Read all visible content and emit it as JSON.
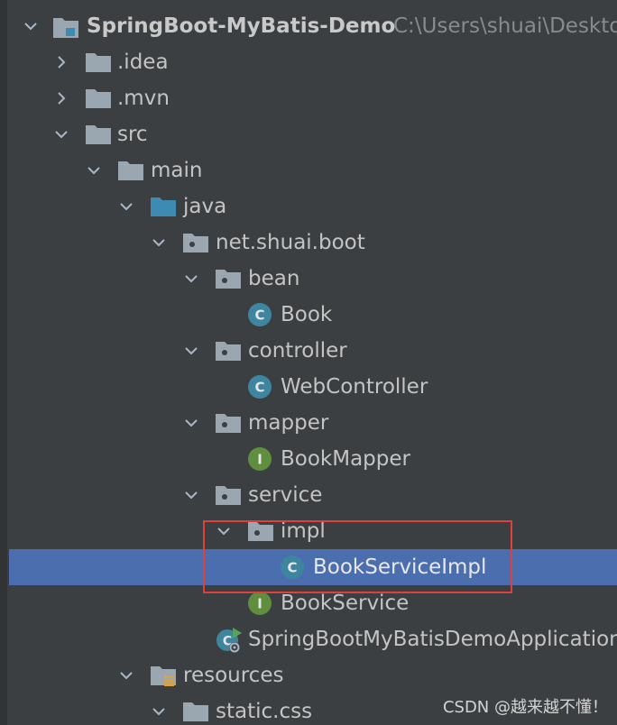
{
  "project": {
    "name": "SpringBoot-MyBatis-Demo",
    "path": "C:\\Users\\shuai\\Deskto"
  },
  "tree": {
    "idea": ".idea",
    "mvn": ".mvn",
    "src": "src",
    "main": "main",
    "java": "java",
    "package": "net.shuai.boot",
    "bean": "bean",
    "book": "Book",
    "controller": "controller",
    "web_controller": "WebController",
    "mapper": "mapper",
    "book_mapper": "BookMapper",
    "service": "service",
    "impl": "impl",
    "book_service_impl": "BookServiceImpl",
    "book_service": "BookService",
    "application": "SpringBootMyBatisDemoApplication",
    "resources": "resources",
    "static_css": "static.css"
  },
  "icons": {
    "class_letter": "C",
    "interface_letter": "I"
  },
  "colors": {
    "background": "#3c3f41",
    "selection": "#4b6eaf",
    "highlight_box": "#e0403c",
    "class_icon": "#3e86a0",
    "interface_icon": "#5f8f3e",
    "source_folder": "#3d8ab3"
  },
  "watermark": "CSDN @越来越不懂！"
}
